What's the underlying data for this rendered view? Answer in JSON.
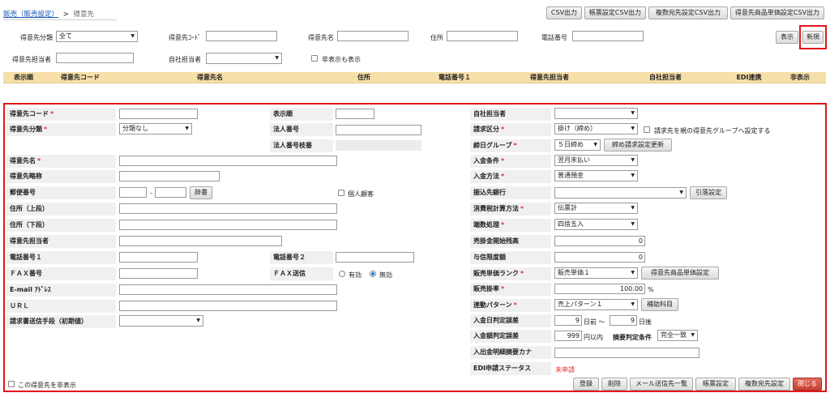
{
  "breadcrumb": {
    "parent": "販売（販売設定）",
    "sep": ">",
    "current": "得意先"
  },
  "top_buttons": [
    "CSV出力",
    "帳票設定CSV出力",
    "複数宛先設定CSV出力",
    "得意先商品単価設定CSV出力"
  ],
  "search": {
    "category_label": "得意先分類",
    "category_value": "全て",
    "code_label": "得意先ｺｰﾄﾞ",
    "name_label": "得意先名",
    "address_label": "住所",
    "phone_label": "電話番号",
    "person_label": "得意先担当者",
    "own_person_label": "自社担当者",
    "show_hidden_label": "非表示も表示",
    "display_button": "表示",
    "new_button": "新規"
  },
  "table_headers": [
    "表示順",
    "得意先コード",
    "得意先名",
    "住所",
    "電話番号１",
    "得意先担当者",
    "自社担当者",
    "EDI連携",
    "非表示"
  ],
  "form": {
    "left": {
      "code": "得意先コード",
      "category": "得意先分類",
      "category_value": "分類なし",
      "name": "得意先名",
      "short_name": "得意先略称",
      "zip": "郵便番号",
      "zip_sep": "-",
      "dict_button": "辞書",
      "individual": "個人顧客",
      "addr1": "住所（上段）",
      "addr2": "住所（下段）",
      "person": "得意先担当者",
      "tel1": "電話番号１",
      "fax": "ＦＡＸ番号",
      "email": "E-mail ｱﾄﾞﾚｽ",
      "url": "ＵＲＬ",
      "invoice_method": "請求書送信手段（初期値）"
    },
    "middle": {
      "order": "表示順",
      "corp_no": "法人番号",
      "corp_branch": "法人番号枝番",
      "tel2": "電話番号２",
      "fax_send": "ＦＡＸ送信",
      "fax_yes": "有効",
      "fax_no": "無効"
    },
    "right": {
      "own_person": "自社担当者",
      "billing_type": "請求区分",
      "billing_value": "掛け（締め）",
      "parent_group": "請求先を親の得意先グループへ設定する",
      "closing_group": "締日グループ",
      "closing_value": "５日締め",
      "closing_update_button": "締め請求設定更新",
      "payment_terms": "入金条件",
      "payment_terms_value": "翌月末払い",
      "payment_method": "入金方法",
      "payment_method_value": "普通預金",
      "bank": "振込先銀行",
      "bank_button": "引落設定",
      "tax_calc": "消費税計算方法",
      "tax_calc_value": "伝票計",
      "rounding": "端数処理",
      "rounding_value": "四捨五入",
      "ar_balance": "売掛金開始残高",
      "ar_balance_value": "0",
      "credit_limit": "与信限度額",
      "credit_limit_value": "0",
      "price_rank": "販売単価ランク",
      "price_rank_value": "販売単価１",
      "price_rank_button": "得意先商品単価設定",
      "rate": "販売掛率",
      "rate_value": "100.00",
      "rate_unit": "%",
      "pattern": "連動パターン",
      "pattern_value": "売上パターン１",
      "pattern_button": "補助科目",
      "date_tolerance": "入金日判定誤差",
      "date_before_value": "9",
      "date_before": "日前 ～",
      "date_after_value": "9",
      "date_after": "日後",
      "amount_tolerance": "入金額判定誤差",
      "amount_value": "999",
      "amount_unit": "円以内",
      "summary_cond": "摘要判定条件",
      "summary_cond_value": "完全一致",
      "kana": "入出金明細摘要カナ",
      "edi_status": "EDI申請ステータス",
      "edi_status_value": "未申請"
    },
    "hide_customer": "この得意先を非表示",
    "bottom_buttons": [
      "登録",
      "削除",
      "メール送信先一覧",
      "帳票設定",
      "複数宛先設定",
      "閉じる"
    ]
  },
  "colors": {
    "accent_red": "#e0171c",
    "header_bg": "#f6dfa9",
    "required": "#d33333"
  }
}
